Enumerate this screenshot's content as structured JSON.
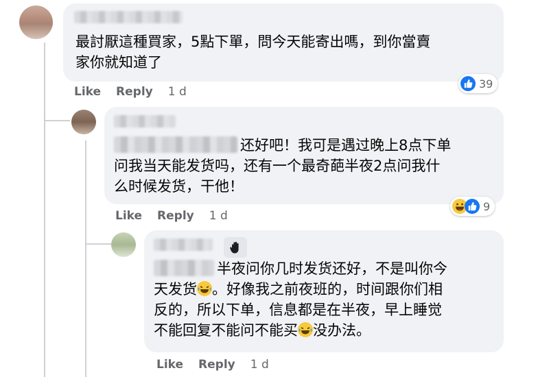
{
  "actions": {
    "like": "Like",
    "reply": "Reply",
    "time": "1 d"
  },
  "comments": [
    {
      "lines": [
        "最討厭這種買家，5點下單，問今天能寄出嗎，到你當賣",
        "家你就知道了"
      ],
      "reaction": {
        "icons": [
          "like-icon"
        ],
        "count": "39"
      }
    },
    {
      "lines": [
        "还好吧！我可是遇过晚上8点下单",
        "问我当天能发货吗，还有一个最奇葩半夜2点问我什",
        "么时候发货，干他！"
      ],
      "reaction": {
        "icons": [
          "haha-icon",
          "like-icon"
        ],
        "count": "9"
      }
    },
    {
      "lines": [
        "半夜问你几时发货还好，不是叫你今",
        "天发货",
        "。好像我之前夜班的，时间跟你们相",
        "反的，所以下单，信息都是在半夜，早上睡觉",
        "不能回复不能问不能买",
        "没办法。"
      ]
    }
  ],
  "colors": {
    "bubble": "#f0f2f5",
    "meta_text": "#65676b",
    "like_blue": "#1877f2",
    "thread_line": "#ced0d4"
  }
}
